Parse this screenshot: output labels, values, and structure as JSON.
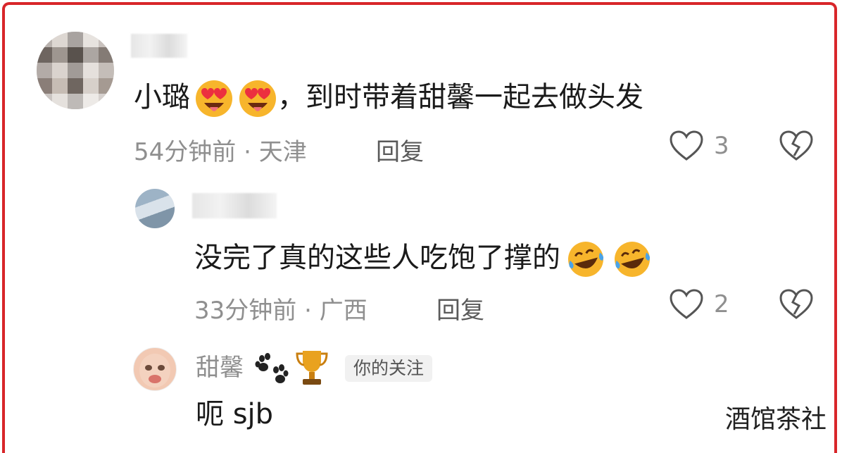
{
  "comments": [
    {
      "text": "小璐",
      "text_after": "，到时带着甜馨一起去做头发",
      "emoji": "heart-eyes",
      "time": "54分钟前",
      "location": "天津",
      "reply_label": "回复",
      "likes": "3"
    },
    {
      "text": "没完了真的这些人吃饱了撑的",
      "emoji": "laugh-cry",
      "time": "33分钟前",
      "location": "广西",
      "reply_label": "回复",
      "likes": "2"
    },
    {
      "username": "甜馨",
      "badge": "你的关注",
      "text": "呃 sjb"
    }
  ],
  "separator": "·",
  "watermark": "酒馆茶社",
  "colors": {
    "frame": "#d8262a",
    "meta": "#8f8f8f"
  }
}
